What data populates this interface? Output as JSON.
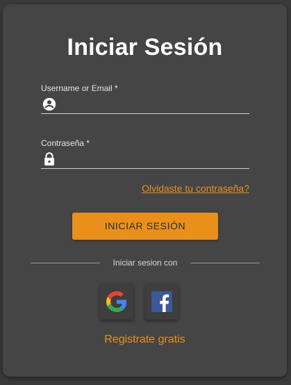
{
  "login": {
    "title": "Iniciar Sesión",
    "username": {
      "label": "Username or Email *",
      "value": "",
      "icon": "account-circle-icon"
    },
    "password": {
      "label": "Contraseña *",
      "value": "",
      "icon": "lock-icon"
    },
    "forgot_link": "Olvidaste tu contraseña?",
    "submit_label": "INICIAR SESIÓN",
    "divider_text": "Iniciar sesion con",
    "social": [
      {
        "name": "Google",
        "icon": "google-icon"
      },
      {
        "name": "Facebook",
        "icon": "facebook-icon"
      }
    ],
    "register_link": "Registrate gratis"
  },
  "colors": {
    "background": "#3a3a3a",
    "card": "#454545",
    "accent": "#e8901a",
    "text": "#ffffff",
    "facebook": "#3b5998"
  }
}
